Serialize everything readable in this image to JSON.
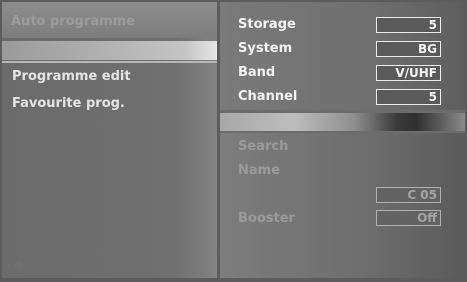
{
  "left_menu": {
    "top_item": "Auto programme",
    "items": [
      "Programme edit",
      "Favourite prog."
    ]
  },
  "right_panel": {
    "rows": [
      {
        "label": "Storage",
        "value": "5"
      },
      {
        "label": "System",
        "value": "BG"
      },
      {
        "label": "Band",
        "value": "V/UHF"
      },
      {
        "label": "Channel",
        "value": "5"
      }
    ],
    "search_label": "Search",
    "name_label": "Name",
    "name_value": "C 05",
    "booster_label": "Booster",
    "booster_value": "Off"
  }
}
